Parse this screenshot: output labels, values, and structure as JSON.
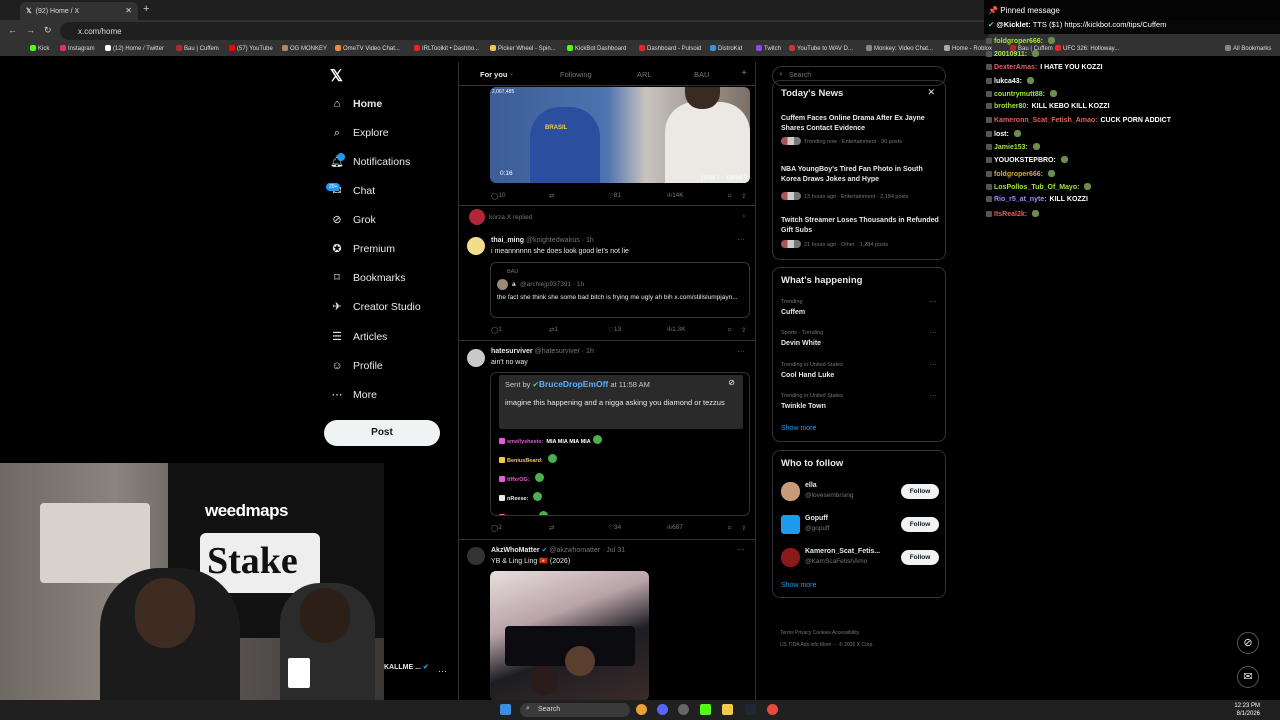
{
  "browser": {
    "tab_title": "(92) Home / X",
    "url": "x.com/home",
    "bookmarks": [
      "Kick",
      "Instagram",
      "(12) Home / Twitter",
      "Bau | Cuffem",
      "(57) YouTube",
      "OG MONKEY",
      "OmeTV Video Chat...",
      "IRLToolkit • Dashbo...",
      "Picker Wheel - Spin...",
      "KickBot Dashboard",
      "Dashboard - Pulsoid",
      "DistroKid",
      "Twitch",
      "YouTube to WAV D...",
      "Monkey: Video Chat...",
      "Home - Roblox",
      "Bau | Cuffem",
      "UFC 326: Holloway..."
    ],
    "all_bookmarks": "All Bookmarks"
  },
  "nav": {
    "items": [
      {
        "label": "Home",
        "icon": "home-icon"
      },
      {
        "label": "Explore",
        "icon": "search-icon"
      },
      {
        "label": "Notifications",
        "icon": "bell-icon"
      },
      {
        "label": "Chat",
        "icon": "chat-icon"
      },
      {
        "label": "Grok",
        "icon": "grok-icon"
      },
      {
        "label": "Premium",
        "icon": "premium-icon"
      },
      {
        "label": "Bookmarks",
        "icon": "bookmark-icon"
      },
      {
        "label": "Creator Studio",
        "icon": "rocket-icon"
      },
      {
        "label": "Articles",
        "icon": "article-icon"
      },
      {
        "label": "Profile",
        "icon": "person-icon"
      },
      {
        "label": "More",
        "icon": "more-icon"
      }
    ],
    "post_label": "Post",
    "chat_badge": "20+",
    "account_name": "KALLME ..."
  },
  "timeline": {
    "tabs": [
      "For you",
      "Following",
      "ARL",
      "BAU"
    ],
    "tweet0": {
      "views_overlay": "2,067,485",
      "duration": "0:16",
      "caption": "jamal 1 - speed 0",
      "replies": "10",
      "likes": "81",
      "views": "14K"
    },
    "replied_by": "korza X replied",
    "tweet1": {
      "name": "thai_ming",
      "handle": "@knightedwalrus · 1h",
      "text": "i meannnnnn she does look good let's not lie",
      "quote_context": "BAU",
      "quote_name": "a",
      "quote_handle": "@archiejp937391 · 1h",
      "quote_text": "the fact she think she some bad bitch is frying me ugly ah bih x.com/stillslumpjayn...",
      "replies": "1",
      "reposts": "1",
      "likes": "13",
      "views": "1.3K"
    },
    "tweet2": {
      "name": "hatesurviver",
      "handle": "@hatesurviver · 1h",
      "text": "ain't no way",
      "sent_by_prefix": "Sent by",
      "sent_by_user": "BruceDropEmOff",
      "sent_by_time": "at 11:58 AM",
      "media_text": "imagine this happening and a nigga asking you diamond or tezzus",
      "chat_lines": [
        {
          "user": "smellysheets:",
          "msg": "MIA    MIA    MIA    MIA",
          "color": "#e15cd6"
        },
        {
          "user": "BeniusBeard:",
          "msg": "",
          "color": "#f2c94c"
        },
        {
          "user": "tiffxrOG:",
          "msg": "",
          "color": "#e15cd6"
        },
        {
          "user": "nReese:",
          "msg": "",
          "color": "#e7e9ea"
        },
        {
          "user": "dmakLPF:",
          "msg": "",
          "color": "#e15cd6"
        }
      ],
      "replies": "2",
      "likes": "34",
      "views": "687"
    },
    "tweet3": {
      "name": "AkzWhoMatter",
      "handle": "@akzwhomatter · Jul 31",
      "text": "YB & Ling Ling 🇻🇳 (2026)"
    }
  },
  "right": {
    "search_placeholder": "Search",
    "news_title": "Today's News",
    "news": [
      {
        "headline": "Cuffem Faces Online Drama After Ex Jayne Shares Contact Evidence",
        "meta": "Trending now · Entertainment · 90 posts"
      },
      {
        "headline": "NBA YoungBoy's Tired Fan Photo in South Korea Draws Jokes and Hype",
        "meta": "13 hours ago · Entertainment · 2,184 posts"
      },
      {
        "headline": "Twitch Streamer Loses Thousands in Refunded Gift Subs",
        "meta": "21 hours ago · Other · 1,284 posts"
      }
    ],
    "happening_title": "What's happening",
    "trends": [
      {
        "context": "Trending",
        "topic": "Cuffem"
      },
      {
        "context": "Sports · Trending",
        "topic": "Devin White"
      },
      {
        "context": "Trending in United States",
        "topic": "Cool Hand Luke"
      },
      {
        "context": "Trending in United States",
        "topic": "Twinkle Town"
      }
    ],
    "show_more": "Show more",
    "wtf_title": "Who to follow",
    "follows": [
      {
        "name": "ella",
        "handle": "@lovesembrsing"
      },
      {
        "name": "Gopuff",
        "handle": "@gopuff"
      },
      {
        "name": "Kameron_Scat_Fetis...",
        "handle": "@KamScaFetishAmo"
      }
    ],
    "follow_label": "Follow",
    "footer1": "Terms    Privacy    Cookies    Accessibility",
    "footer2": "US TIDA    Ads info    More ···    © 2026 X Corp."
  },
  "chat": {
    "pinned": "Pinned message",
    "pinned_user": "@Kicklet:",
    "pinned_msg": "TTS ($1) https://kickbot.com/tips/Cuffem",
    "lines": [
      {
        "user": "foldgroper666:",
        "msg": "",
        "color": "#a3e635"
      },
      {
        "user": "20010911:",
        "msg": "",
        "color": "#a3e635"
      },
      {
        "user": "DexterAmas:",
        "msg": "I HATE YOU KOZZI",
        "color": "#e85d5d"
      },
      {
        "user": "lukca43:",
        "msg": "",
        "color": "#ffffff"
      },
      {
        "user": "countrymutt88:",
        "msg": "",
        "color": "#a3e635"
      },
      {
        "user": "brother80:",
        "msg": "KILL KEBO KILL KOZZI",
        "color": "#a3e635"
      },
      {
        "user": "Kameronn_Scat_Fetish_Amao:",
        "msg": "CUCK PORN ADDICT",
        "color": "#e85d5d"
      },
      {
        "user": "lost:",
        "msg": "",
        "color": "#ffffff"
      },
      {
        "user": "Jamie153:",
        "msg": "",
        "color": "#a3e635"
      },
      {
        "user": "YOUOKSTEPBRO:",
        "msg": "",
        "color": "#ffffff"
      },
      {
        "user": "foldgroper666:",
        "msg": "",
        "color": "#e0a63a"
      },
      {
        "user": "LosPollos_Tub_Of_Mayo:",
        "msg": "",
        "color": "#a3e635"
      },
      {
        "user": "Rio_r5_at_nyte:",
        "msg": "KILL KOZZI",
        "color": "#a78bfa"
      },
      {
        "user": "ItsReal2k:",
        "msg": "",
        "color": "#e85d5d"
      }
    ]
  },
  "webcam": {
    "banner_top": "weedmaps",
    "banner_main": "Stake"
  },
  "taskbar": {
    "search": "Search",
    "time": "12:23 PM",
    "date": "8/1/2026"
  },
  "colors": {
    "accent": "#1d9bf0",
    "background": "#000000",
    "border": "#2f3336",
    "muted": "#71767b"
  }
}
